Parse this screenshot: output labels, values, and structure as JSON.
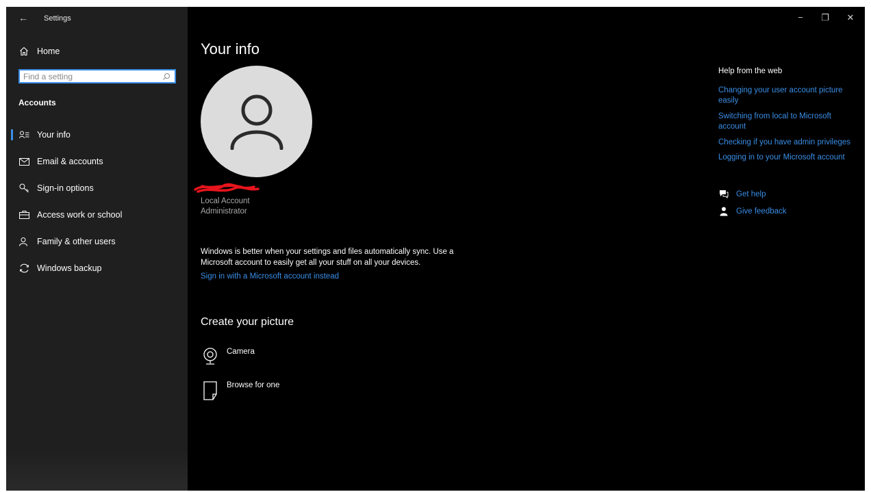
{
  "window": {
    "title": "Settings",
    "back_glyph": "←",
    "minimize_glyph": "−",
    "maximize_glyph": "❐",
    "close_glyph": "✕"
  },
  "sidebar": {
    "home_label": "Home",
    "search_placeholder": "Find a setting",
    "section_heading": "Accounts",
    "items": [
      {
        "label": "Your info",
        "icon": "person-lines-icon",
        "active": true
      },
      {
        "label": "Email & accounts",
        "icon": "mail-icon",
        "active": false
      },
      {
        "label": "Sign-in options",
        "icon": "key-icon",
        "active": false
      },
      {
        "label": "Access work or school",
        "icon": "briefcase-icon",
        "active": false
      },
      {
        "label": "Family & other users",
        "icon": "person-add-icon",
        "active": false
      },
      {
        "label": "Windows backup",
        "icon": "sync-icon",
        "active": false
      }
    ]
  },
  "main": {
    "title": "Your info",
    "account_type": "Local Account",
    "account_role": "Administrator",
    "sync_message": "Windows is better when your settings and files automatically sync. Use a Microsoft account to easily get all your stuff on all your devices.",
    "ms_link": "Sign in with a Microsoft account instead",
    "create_heading": "Create your picture",
    "picture_options": [
      {
        "label": "Camera",
        "icon": "camera-icon"
      },
      {
        "label": "Browse for one",
        "icon": "browse-file-icon"
      }
    ]
  },
  "help": {
    "heading": "Help from the web",
    "links": [
      "Changing your user account picture easily",
      "Switching from local to Microsoft account",
      "Checking if you have admin privileges",
      "Logging in to your Microsoft account"
    ],
    "get_help": "Get help",
    "give_feedback": "Give feedback"
  },
  "colors": {
    "accent": "#3a8ee6",
    "sidebar_bg": "#1f1f1f",
    "content_bg": "#000000",
    "redaction": "#e8141c"
  }
}
